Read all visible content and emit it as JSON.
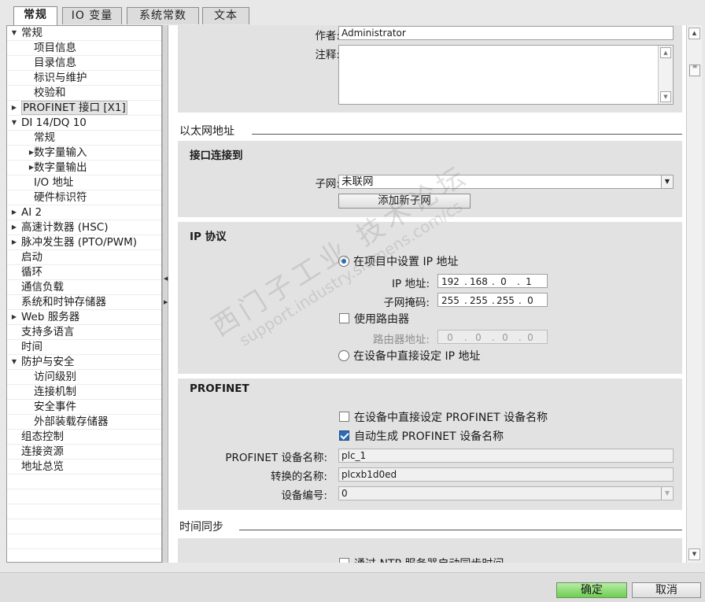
{
  "tabs": [
    "常规",
    "IO 变量",
    "系统常数",
    "文本"
  ],
  "tree": [
    {
      "label": "常规",
      "indent": 0,
      "arrow": "down"
    },
    {
      "label": "项目信息",
      "indent": 2,
      "arrow": ""
    },
    {
      "label": "目录信息",
      "indent": 2,
      "arrow": ""
    },
    {
      "label": "标识与维护",
      "indent": 2,
      "arrow": ""
    },
    {
      "label": "校验和",
      "indent": 2,
      "arrow": ""
    },
    {
      "label": "PROFINET 接口 [X1]",
      "indent": 0,
      "arrow": "right",
      "selected": true
    },
    {
      "label": "DI 14/DQ 10",
      "indent": 0,
      "arrow": "down"
    },
    {
      "label": "常规",
      "indent": 2,
      "arrow": ""
    },
    {
      "label": "数字量输入",
      "indent": 2,
      "arrow": "right"
    },
    {
      "label": "数字量输出",
      "indent": 2,
      "arrow": "right"
    },
    {
      "label": "I/O 地址",
      "indent": 2,
      "arrow": ""
    },
    {
      "label": "硬件标识符",
      "indent": 2,
      "arrow": ""
    },
    {
      "label": "AI 2",
      "indent": 0,
      "arrow": "right"
    },
    {
      "label": "高速计数器 (HSC)",
      "indent": 0,
      "arrow": "right"
    },
    {
      "label": "脉冲发生器 (PTO/PWM)",
      "indent": 0,
      "arrow": "right"
    },
    {
      "label": "启动",
      "indent": 0,
      "arrow": ""
    },
    {
      "label": "循环",
      "indent": 0,
      "arrow": ""
    },
    {
      "label": "通信负载",
      "indent": 0,
      "arrow": ""
    },
    {
      "label": "系统和时钟存储器",
      "indent": 0,
      "arrow": ""
    },
    {
      "label": "Web 服务器",
      "indent": 0,
      "arrow": "right"
    },
    {
      "label": "支持多语言",
      "indent": 0,
      "arrow": ""
    },
    {
      "label": "时间",
      "indent": 0,
      "arrow": ""
    },
    {
      "label": "防护与安全",
      "indent": 0,
      "arrow": "down"
    },
    {
      "label": "访问级别",
      "indent": 2,
      "arrow": ""
    },
    {
      "label": "连接机制",
      "indent": 2,
      "arrow": ""
    },
    {
      "label": "安全事件",
      "indent": 2,
      "arrow": ""
    },
    {
      "label": "外部装载存储器",
      "indent": 2,
      "arrow": ""
    },
    {
      "label": "组态控制",
      "indent": 0,
      "arrow": ""
    },
    {
      "label": "连接资源",
      "indent": 0,
      "arrow": ""
    },
    {
      "label": "地址总览",
      "indent": 0,
      "arrow": ""
    }
  ],
  "general": {
    "author_label": "作者:",
    "author_value": "Administrator",
    "comment_label": "注释:",
    "comment_value": ""
  },
  "ethernet": {
    "section_title": "以太网地址",
    "interface_title": "接口连接到",
    "subnet_label": "子网:",
    "subnet_value": "未联网",
    "add_subnet_button": "添加新子网"
  },
  "ip": {
    "title": "IP 协议",
    "set_in_project_label": "在项目中设置 IP 地址",
    "ip_address_label": "IP 地址:",
    "ip_address": [
      "192",
      "168",
      "0",
      "1"
    ],
    "subnet_mask_label": "子网掩码:",
    "subnet_mask": [
      "255",
      "255",
      "255",
      "0"
    ],
    "use_router_label": "使用路由器",
    "router_address_label": "路由器地址:",
    "router_address": [
      "0",
      "0",
      "0",
      "0"
    ],
    "set_on_device_label": "在设备中直接设定 IP 地址",
    "set_in_project_selected": true,
    "use_router_checked": false
  },
  "profinet": {
    "title": "PROFINET",
    "set_name_on_device_label": "在设备中直接设定 PROFINET 设备名称",
    "set_name_on_device_checked": false,
    "auto_generate_label": "自动生成 PROFINET 设备名称",
    "auto_generate_checked": true,
    "device_name_label": "PROFINET 设备名称:",
    "device_name_value": "plc_1",
    "converted_name_label": "转换的名称:",
    "converted_name_value": "plcxb1d0ed",
    "device_number_label": "设备编号:",
    "device_number_value": "0"
  },
  "time_sync": {
    "section_title": "时间同步",
    "ntp_label": "通过 NTP 服务器启动同步时间"
  },
  "footer": {
    "ok_label": "确定",
    "cancel_label": "取消"
  },
  "watermark": {
    "line1": "西门子工业  技术论坛",
    "line2": "support.industry.siemens.com/cs"
  },
  "colors": {
    "accent": "#2a6db5",
    "ok_button": "#6ece50",
    "group_bg": "#e2e2e2"
  }
}
